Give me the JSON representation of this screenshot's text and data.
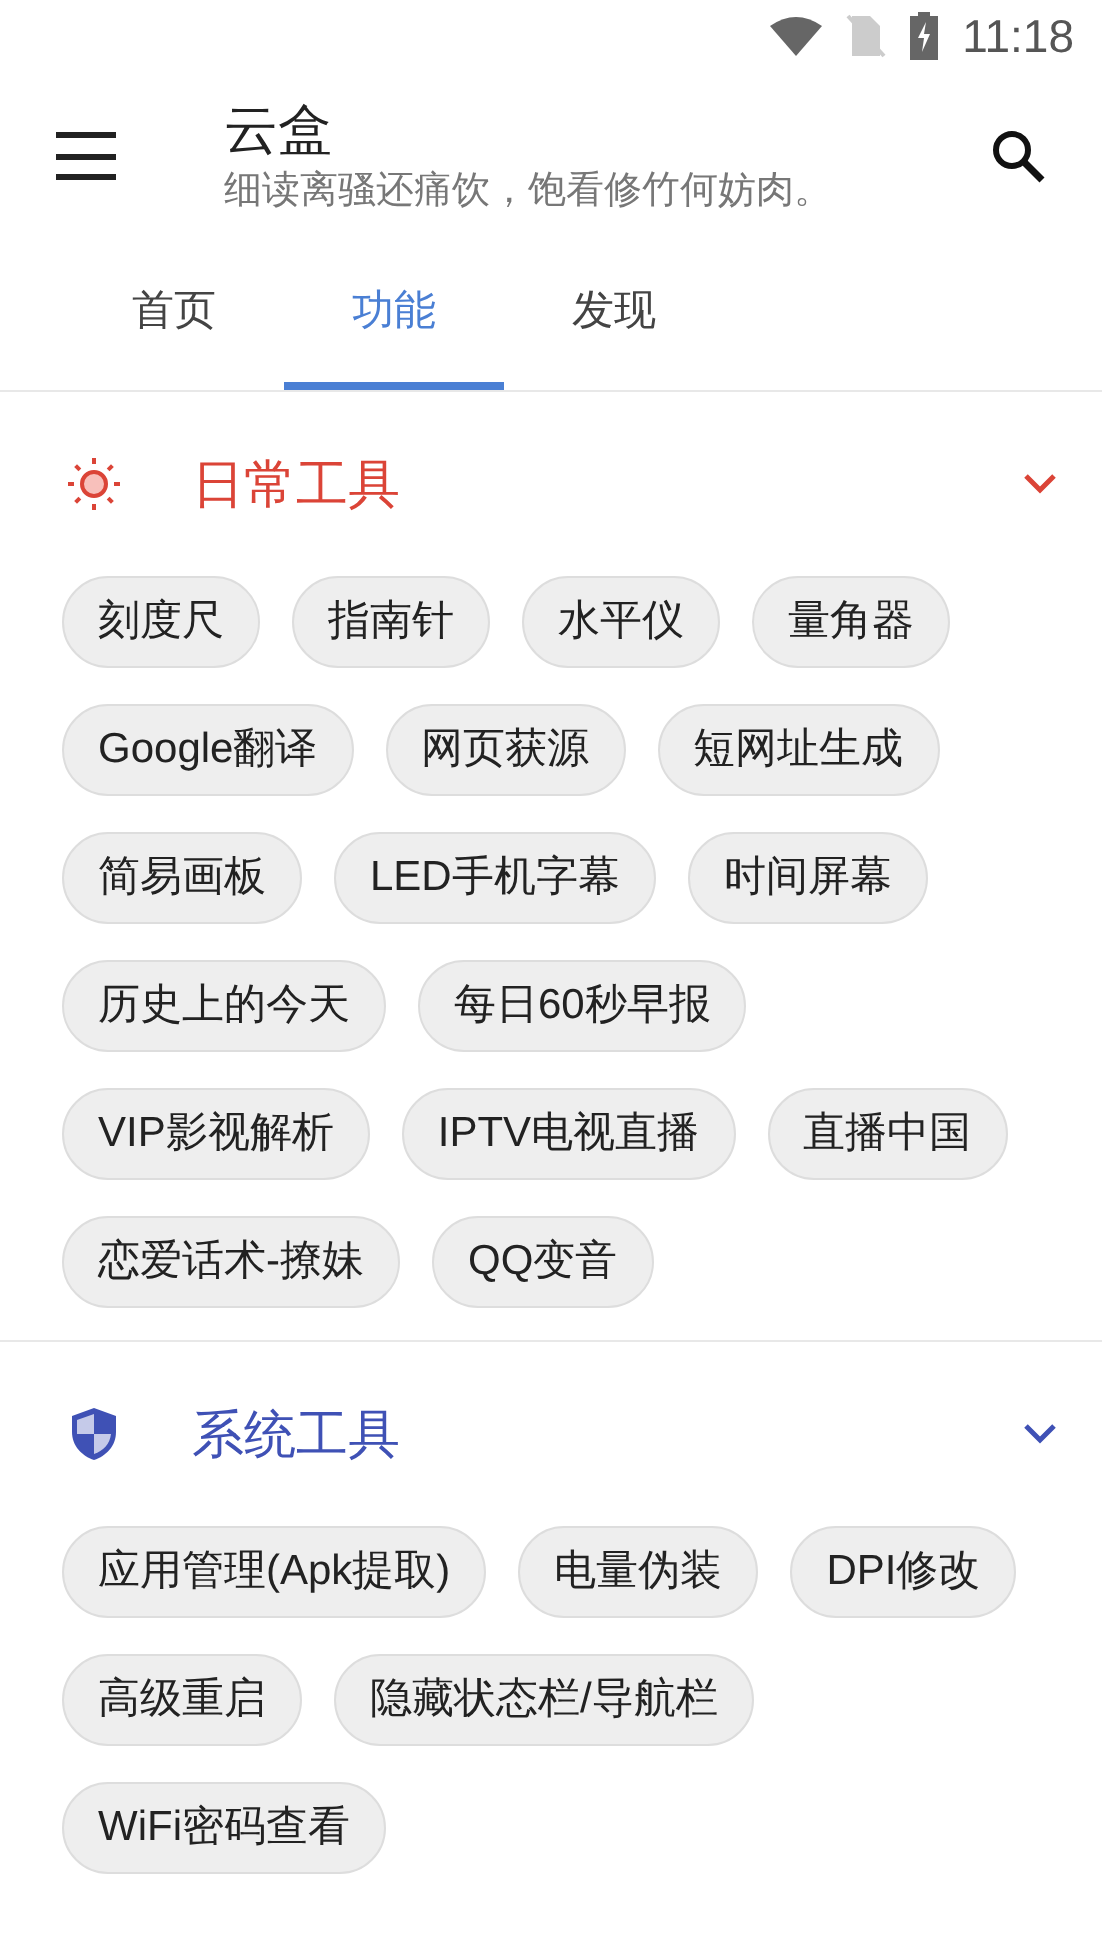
{
  "status_bar": {
    "time": "11:18"
  },
  "app_bar": {
    "title": "云盒",
    "subtitle": "细读离骚还痛饮，饱看修竹何妨肉。"
  },
  "tabs": [
    {
      "label": "首页",
      "selected": false
    },
    {
      "label": "功能",
      "selected": true
    },
    {
      "label": "发现",
      "selected": false
    }
  ],
  "sections": [
    {
      "kind": "sun",
      "title": "日常工具",
      "color": "#db4437",
      "expanded": true,
      "items": [
        "刻度尺",
        "指南针",
        "水平仪",
        "量角器",
        "Google翻译",
        "网页获源",
        "短网址生成",
        "简易画板",
        "LED手机字幕",
        "时间屏幕",
        "历史上的今天",
        "每日60秒早报",
        "VIP影视解析",
        "IPTV电视直播",
        "直播中国",
        "恋爱话术-撩妹",
        "QQ变音"
      ]
    },
    {
      "kind": "shield",
      "title": "系统工具",
      "color": "#3f51b5",
      "expanded": true,
      "items": [
        "应用管理(Apk提取)",
        "电量伪装",
        "DPI修改",
        "高级重启",
        "隐藏状态栏/导航栏",
        "WiFi密码查看"
      ]
    }
  ]
}
